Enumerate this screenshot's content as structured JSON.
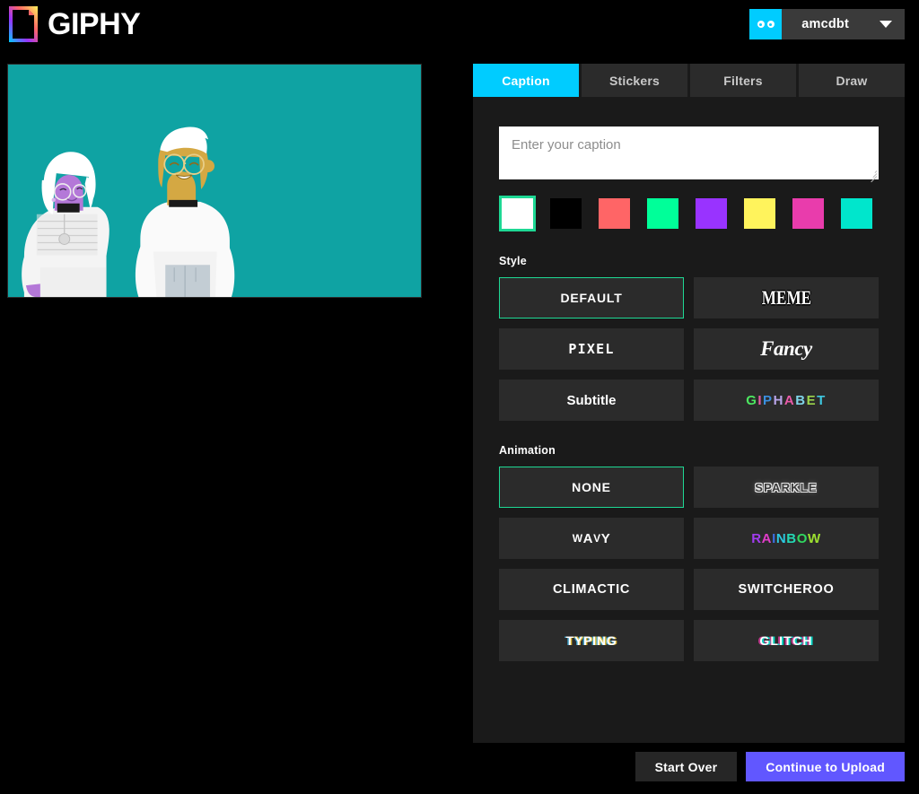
{
  "header": {
    "brand": "GIPHY",
    "logo_icon": "giphy-logo-icon",
    "account": {
      "avatar_icon": "eyes-avatar-icon",
      "username": "amcdbt",
      "caret_icon": "chevron-down-icon"
    }
  },
  "preview": {
    "name": "gif-preview",
    "background_color": "#0FA3A3",
    "characters": [
      {
        "name": "left-character",
        "skin_color": "#B478D8",
        "hair_color": "#FFFFFF",
        "shirt_color": "#F2F2F2"
      },
      {
        "name": "right-character",
        "skin_color": "#D4A843",
        "hair_color": "#FFFFFF",
        "shirt_color": "#FFFFFF"
      }
    ]
  },
  "tabs": [
    {
      "label": "Caption",
      "active": true
    },
    {
      "label": "Stickers",
      "active": false
    },
    {
      "label": "Filters",
      "active": false
    },
    {
      "label": "Draw",
      "active": false
    }
  ],
  "caption": {
    "value": "",
    "placeholder": "Enter your caption"
  },
  "colors": {
    "selected_index": 0,
    "selection_border": "#1ED894",
    "swatches": [
      {
        "name": "white",
        "hex": "#FFFFFF"
      },
      {
        "name": "black",
        "hex": "#000000"
      },
      {
        "name": "red",
        "hex": "#FF6566"
      },
      {
        "name": "green",
        "hex": "#00FF99"
      },
      {
        "name": "purple",
        "hex": "#9933FF"
      },
      {
        "name": "yellow",
        "hex": "#FFF35C"
      },
      {
        "name": "pink",
        "hex": "#E93CAC"
      },
      {
        "name": "teal",
        "hex": "#00E6CC"
      }
    ]
  },
  "style": {
    "label": "Style",
    "selected": "DEFAULT",
    "options": [
      {
        "label": "DEFAULT",
        "variant": "t-default",
        "selected": true
      },
      {
        "label": "MEME",
        "variant": "t-meme",
        "selected": false
      },
      {
        "label": "PIXEL",
        "variant": "t-pixel",
        "selected": false
      },
      {
        "label": "Fancy",
        "variant": "t-fancy",
        "selected": false
      },
      {
        "label": "Subtitle",
        "variant": "t-subtitle",
        "selected": false
      },
      {
        "label": "GIPHABET",
        "variant": "t-giphabet",
        "selected": false
      }
    ]
  },
  "animation": {
    "label": "Animation",
    "selected": "NONE",
    "options": [
      {
        "label": "NONE",
        "variant": "t-none",
        "selected": true
      },
      {
        "label": "SPARKLE",
        "variant": "t-sparkle",
        "selected": false
      },
      {
        "label": "WAVY",
        "variant": "t-wavy",
        "selected": false
      },
      {
        "label": "RAINBOW",
        "variant": "t-rainbow",
        "selected": false
      },
      {
        "label": "CLIMACTIC",
        "variant": "t-climactic",
        "selected": false
      },
      {
        "label": "SWITCHEROO",
        "variant": "t-switcheroo",
        "selected": false
      },
      {
        "label": "TYPING",
        "variant": "t-typing",
        "selected": false
      },
      {
        "label": "GLITCH",
        "variant": "t-glitch",
        "selected": false
      }
    ]
  },
  "footer": {
    "start_over": "Start Over",
    "continue_upload": "Continue to Upload",
    "continue_color": "#6157FF"
  }
}
